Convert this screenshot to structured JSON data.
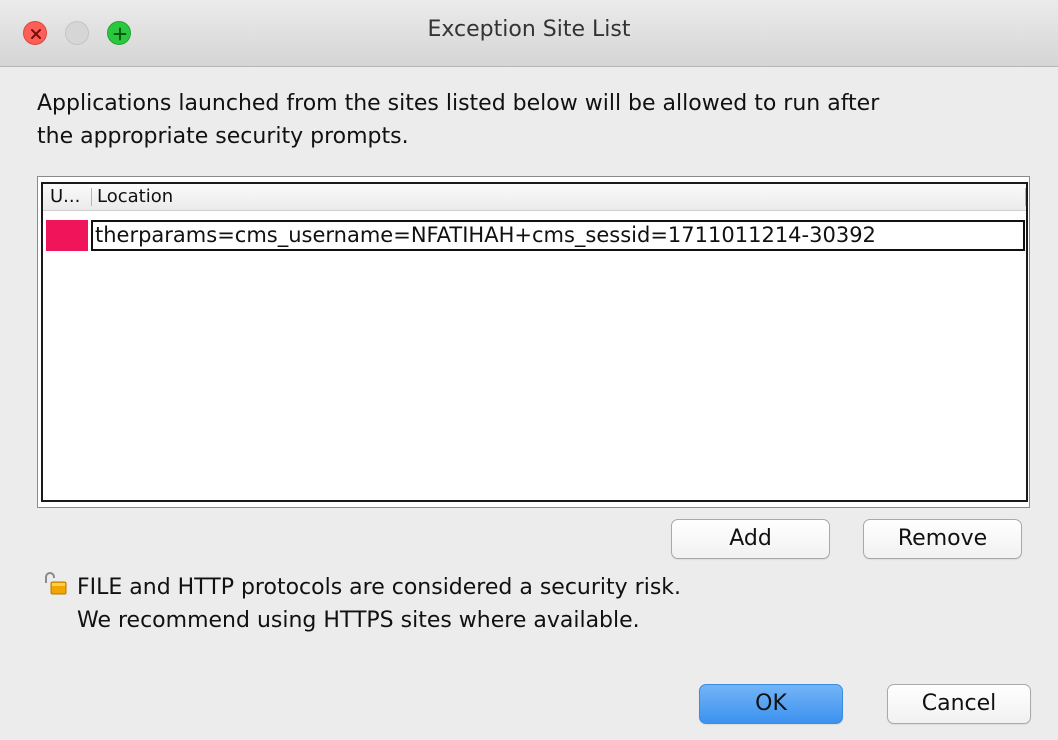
{
  "window": {
    "title": "Exception Site List"
  },
  "description": {
    "line1": "Applications launched from the sites listed below will be allowed to run after",
    "line2": "the appropriate security prompts."
  },
  "table": {
    "columns": [
      "U...",
      "Location"
    ],
    "rows": [
      {
        "status_color": "#f0145a",
        "location": "therparams=cms_username=NFATIHAH+cms_sessid=1711011214-30392"
      }
    ]
  },
  "buttons": {
    "add": "Add",
    "remove": "Remove",
    "ok": "OK",
    "cancel": "Cancel"
  },
  "warning": {
    "icon": "unlocked-padlock-icon",
    "line1": "FILE and HTTP protocols are considered a security risk.",
    "line2": "We recommend using HTTPS sites where available."
  },
  "colors": {
    "accent": "#3c92ee",
    "close": "#fc5f57",
    "maximize": "#2ac83f"
  }
}
